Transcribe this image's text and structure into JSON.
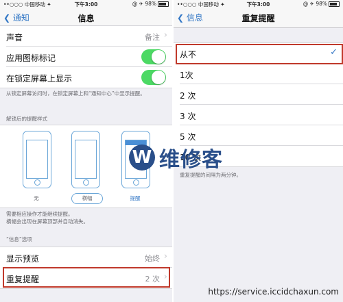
{
  "left": {
    "status": {
      "carrier": "••○○○ 中国移动 ✦",
      "time": "下午3:00",
      "battery": "@ ✈ 98%"
    },
    "nav": {
      "back": "通知",
      "title": "信息"
    },
    "rows": {
      "sound": {
        "label": "声音",
        "value": "备注"
      },
      "badge": {
        "label": "应用图标标记"
      },
      "lockscreen": {
        "label": "在锁定屏幕上显示"
      }
    },
    "lock_note": "从锁定屏幕访问时，在锁定屏幕上和“通知中心”中显示提醒。",
    "style_header": "解锁后的提醒样式",
    "styles": [
      "无",
      "横幅",
      "提醒"
    ],
    "banner_note": "需要相应操作才能继续提醒。\n横幅会出现在屏幕顶部并自动消失。",
    "options_header": "“信息”选项",
    "preview": {
      "label": "显示预览",
      "value": "始终"
    },
    "repeat": {
      "label": "重复提醒",
      "value": "2 次"
    }
  },
  "right": {
    "status": {
      "carrier": "••○○○ 中国移动 ✦",
      "time": "下午3:00",
      "battery": "@ ✈ 98%"
    },
    "nav": {
      "back": "信息",
      "title": "重复提醒"
    },
    "options": [
      "从不",
      "1次",
      "2 次",
      "3 次",
      "5 次",
      "10 次"
    ],
    "selected_index": 0,
    "footer": "重复提醒的间隔为两分钟。"
  },
  "watermark": {
    "logo": "W",
    "text": "维修客",
    "url": "https://service.iccidchaxun.com"
  },
  "colors": {
    "accent": "#3478c6",
    "toggle_on": "#4cd964",
    "highlight": "#c0392b"
  }
}
